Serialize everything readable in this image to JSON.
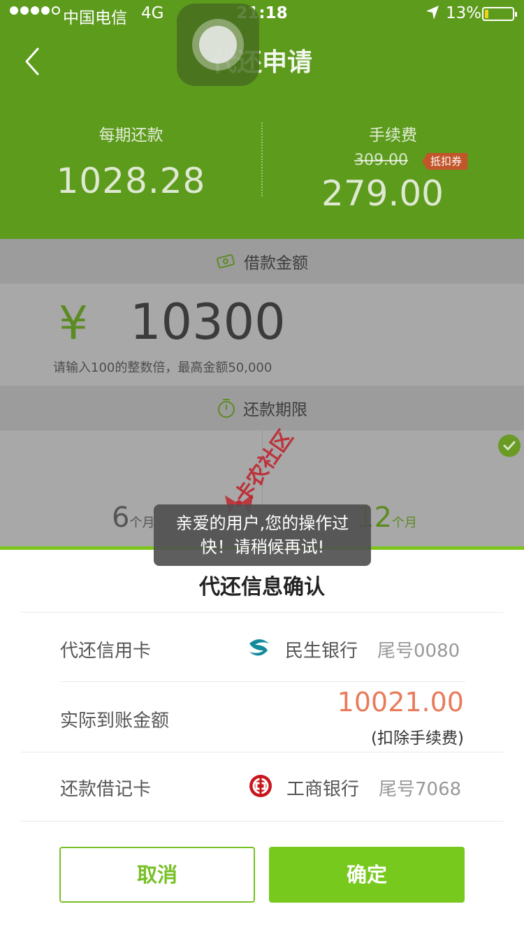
{
  "status_bar": {
    "carrier": "中国电信",
    "network": "4G",
    "time": "21:18",
    "battery_pct": "13%",
    "battery_level": 0.13,
    "battery_color": "#f1d21a"
  },
  "header": {
    "title": "代还申请",
    "per_period_label": "每期还款",
    "per_period_value": "1028.28",
    "fee_label": "手续费",
    "fee_original": "309.00",
    "coupon_badge": "抵扣券",
    "fee_value": "279.00"
  },
  "loan": {
    "section_title": "借款金额",
    "currency": "¥",
    "amount": "10300",
    "hint": "请输入100的整数倍，最高金额50,000"
  },
  "term": {
    "section_title": "还款期限",
    "options": [
      {
        "num": "6",
        "unit": "个月"
      },
      {
        "num": "12",
        "unit": "个月"
      }
    ]
  },
  "sheet": {
    "title": "代还信息确认",
    "credit_card_label": "代还信用卡",
    "credit_card_bank": "民生银行",
    "credit_card_tail": "尾号0080",
    "actual_amount_label": "实际到账金额",
    "actual_amount_value": "10021.00",
    "actual_amount_note": "(扣除手续费)",
    "debit_card_label": "还款借记卡",
    "debit_card_bank": "工商银行",
    "debit_card_tail": "尾号7068",
    "cancel_label": "取消",
    "confirm_label": "确定"
  },
  "toast": {
    "line1": "亲爱的用户,您的操作过",
    "line2": "快！请稍候再试!"
  },
  "watermark": {
    "text": "卡农社区"
  },
  "colors": {
    "header_green": "#5d9b1d",
    "accent_green": "#77c91d",
    "amount_red": "#e97b5b",
    "coupon_red": "#c2552a"
  }
}
